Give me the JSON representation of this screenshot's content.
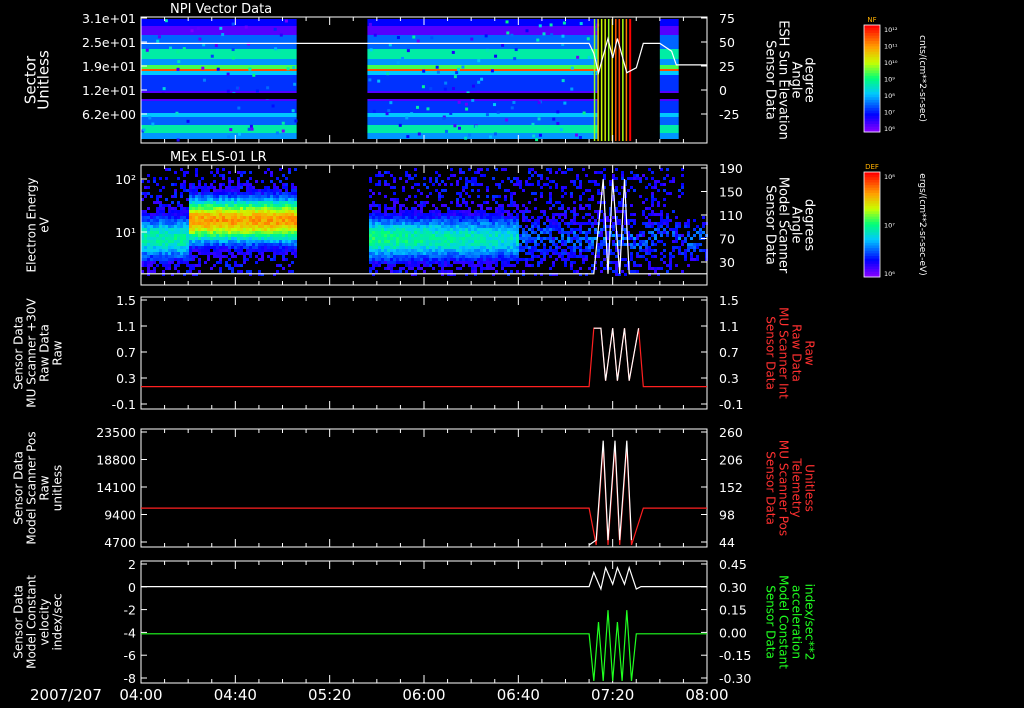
{
  "title": "NPI Vector Data",
  "date_label": "2007/207",
  "time_ticks": [
    "04:00",
    "04:40",
    "05:20",
    "06:00",
    "06:40",
    "07:20",
    "08:00"
  ],
  "colorbars": [
    {
      "title": "NF",
      "unit": "cnts/(cm**2-sr-sec)",
      "ticks": [
        "10¹²",
        "10¹¹",
        "10¹⁰",
        "10⁹",
        "10⁸",
        "10⁷",
        "10⁶"
      ]
    },
    {
      "title": "DEF",
      "unit": "ergs/(cm**2-sr-sec-eV)",
      "ticks": [
        "10⁸",
        "10⁷",
        "10⁶"
      ]
    }
  ],
  "chart_data": [
    {
      "type": "heatmap",
      "title": "NPI Vector Data",
      "ylabel": [
        "Sector",
        "Unitless"
      ],
      "yticks": [
        "3.1e+01",
        "2.5e+01",
        "1.9e+01",
        "1.2e+01",
        "6.2e+00"
      ],
      "ylabel_right": [
        "Sensor Data",
        "ESH Sun Elevation",
        "Angle",
        "degree"
      ],
      "yticks_right": [
        "75",
        "50",
        "25",
        "0",
        "-25"
      ],
      "ylim_right": [
        -50,
        75
      ],
      "overlay": {
        "color": "#ffffff",
        "x": [
          "04:00",
          "05:20",
          "07:10",
          "07:12",
          "07:14",
          "07:18",
          "07:20",
          "07:22",
          "07:26",
          "07:30",
          "07:33",
          "07:40",
          "07:45",
          "07:47",
          "08:00"
        ],
        "y": [
          50,
          50,
          50,
          40,
          20,
          55,
          35,
          55,
          20,
          25,
          50,
          50,
          42,
          28,
          28
        ]
      }
    },
    {
      "type": "heatmap",
      "title": "MEx ELS-01 LR",
      "ylabel": [
        "Electron Energy",
        "eV"
      ],
      "yticks": [
        "10²",
        "10¹"
      ],
      "ylabel_right": [
        "Sensor Data",
        "Model Scanner",
        "Angle",
        "degrees"
      ],
      "yticks_right": [
        "190",
        "150",
        "110",
        "70",
        "30"
      ],
      "ylim_right": [
        0,
        190
      ],
      "overlay": {
        "color": "#ffffff",
        "x": [
          "04:00",
          "07:10",
          "07:12",
          "07:16",
          "07:18",
          "07:20",
          "07:23",
          "07:25",
          "07:27",
          "08:00"
        ],
        "y": [
          15,
          15,
          15,
          170,
          15,
          170,
          15,
          170,
          15,
          15
        ]
      }
    },
    {
      "type": "line",
      "ylabel": [
        "Sensor Data",
        "MU Scanner +30V",
        "Raw Data",
        "Raw"
      ],
      "yticks": [
        "1.5",
        "1.1",
        "0.7",
        "0.3",
        "-0.1"
      ],
      "ylim": [
        -0.35,
        1.5
      ],
      "ylabel_right": [
        "Sensor Data",
        "MU Scanner Int",
        "Raw Data",
        "Raw"
      ],
      "yticks_right": [
        "1.5",
        "1.1",
        "0.7",
        "0.3",
        "-0.1"
      ],
      "series": [
        {
          "color": "#ff2020",
          "x": [
            "04:00",
            "07:10",
            "07:12",
            "07:15",
            "07:17",
            "07:20",
            "07:22",
            "07:25",
            "07:27",
            "07:31",
            "07:33",
            "08:00"
          ],
          "y": [
            0,
            0,
            1,
            1,
            0.1,
            1,
            0.1,
            1,
            0.1,
            1,
            0,
            0
          ]
        },
        {
          "color": "#ffffff",
          "x": [
            "07:12",
            "07:15",
            "07:17",
            "07:20",
            "07:22",
            "07:25",
            "07:27",
            "07:31"
          ],
          "y": [
            1,
            1,
            0.1,
            1,
            0.1,
            1,
            0.1,
            1
          ]
        }
      ]
    },
    {
      "type": "line",
      "ylabel": [
        "Sensor Data",
        "Model Scanner Pos",
        "Raw",
        "unitless"
      ],
      "yticks": [
        "23500",
        "18800",
        "14100",
        "9400",
        "4700"
      ],
      "ylim": [
        0,
        23500
      ],
      "ylabel_right": [
        "Sensor Data",
        "MU Scanner Pos",
        "Telemetry",
        "Unitless"
      ],
      "yticks_right": [
        "260",
        "206",
        "152",
        "98",
        "44"
      ],
      "series": [
        {
          "color": "#ff2020",
          "x": [
            "04:00",
            "07:10",
            "07:13",
            "07:16",
            "07:18",
            "07:21",
            "07:23",
            "07:26",
            "07:28",
            "07:33",
            "08:00"
          ],
          "y": [
            7600,
            7600,
            0,
            20500,
            0,
            20500,
            0,
            20500,
            0,
            7600,
            7600
          ]
        },
        {
          "color": "#ffffff",
          "x": [
            "07:10",
            "07:13",
            "07:16",
            "07:18",
            "07:21",
            "07:23",
            "07:26",
            "07:28"
          ],
          "y": [
            0,
            1000,
            21500,
            1000,
            21500,
            1000,
            21500,
            1000
          ]
        }
      ]
    },
    {
      "type": "line",
      "ylabel": [
        "Sensor Data",
        "Model Constant",
        "velocity",
        "index/sec"
      ],
      "yticks": [
        "2",
        "0",
        "-2",
        "-4",
        "-6",
        "-8"
      ],
      "ylim": [
        -8,
        2
      ],
      "ylabel_right": [
        "Sensor Data",
        "Model Constant",
        "acceleration",
        "index/sec**2"
      ],
      "yticks_right": [
        "0.45",
        "0.30",
        "0.15",
        "0.00",
        "-0.15",
        "-0.30"
      ],
      "series": [
        {
          "color": "#ffffff",
          "x": [
            "04:00",
            "07:10",
            "07:12",
            "07:15",
            "07:17",
            "07:20",
            "07:22",
            "07:25",
            "07:27",
            "07:30",
            "07:32",
            "08:00"
          ],
          "y": [
            0,
            0,
            1.2,
            -0.2,
            1.6,
            0.2,
            1.6,
            0.2,
            1.6,
            -0.2,
            0,
            0
          ]
        },
        {
          "color": "#20ff20",
          "x": [
            "04:00",
            "07:10",
            "07:12",
            "07:14",
            "07:16",
            "07:18",
            "07:20",
            "07:22",
            "07:24",
            "07:26",
            "07:28",
            "07:30",
            "08:00"
          ],
          "y": [
            -4,
            -4,
            -8,
            -3,
            -8,
            -2,
            -8,
            -3,
            -8,
            -2,
            -8,
            -4,
            -4
          ]
        }
      ]
    }
  ]
}
